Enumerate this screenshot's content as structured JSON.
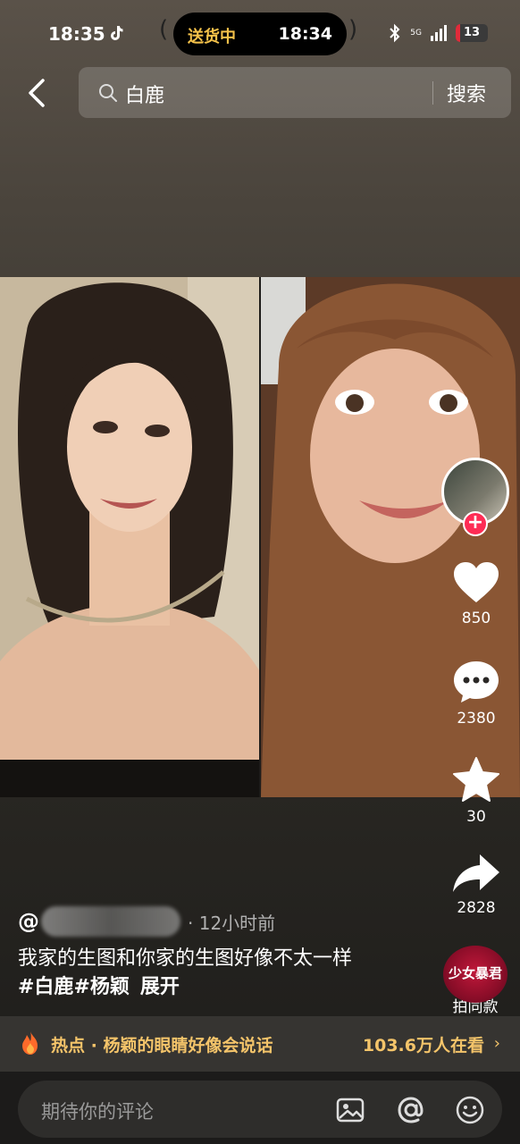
{
  "status_bar": {
    "time": "18:35",
    "live_activity": {
      "label": "送货中",
      "time": "18:34"
    },
    "network": "5G",
    "battery": "13",
    "icons": [
      "tiktok-icon",
      "bluetooth-icon",
      "signal-icon",
      "battery-icon"
    ]
  },
  "header": {
    "back_icon": "back-chevron-icon",
    "search_query": "白鹿",
    "search_button": "搜索"
  },
  "video": {
    "left_photo": "portrait-photo",
    "right_photo": "portrait-photo"
  },
  "actions": {
    "likes": "850",
    "comments": "2380",
    "favorites": "30",
    "shares": "2828",
    "remix_disc_text": "少女暴君",
    "remix_label": "拍同款"
  },
  "post": {
    "author_prefix": "@",
    "time_ago": "· 12小时前",
    "caption": "我家的生图和你家的生图好像不太一样",
    "tags": [
      "#白鹿",
      "#杨颖"
    ],
    "expand": "展开"
  },
  "hot": {
    "text": "热点 · 杨颖的眼睛好像会说话",
    "viewers": "103.6万人在看",
    "chevron": "›"
  },
  "comment_bar": {
    "placeholder": "期待你的评论",
    "icons": [
      "image-icon",
      "mention-icon",
      "emoji-icon"
    ]
  },
  "colors": {
    "accent_red": "#fe2c55",
    "hot_gold": "#f4c46a",
    "delivery_gold": "#f5c24a"
  }
}
